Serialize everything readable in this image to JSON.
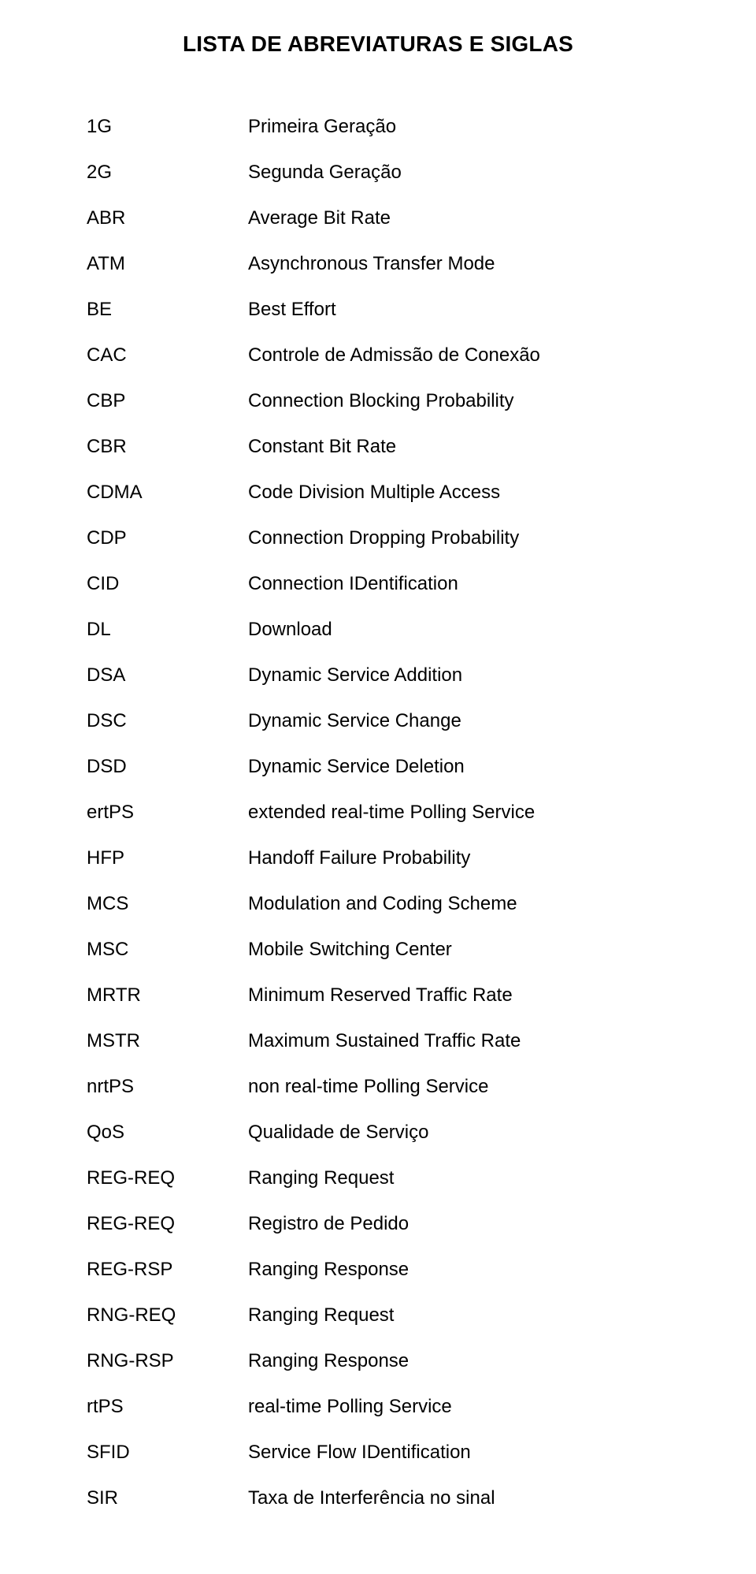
{
  "title": "LISTA DE ABREVIATURAS E SIGLAS",
  "entries": [
    {
      "abbr": "1G",
      "def": "Primeira Geração"
    },
    {
      "abbr": "2G",
      "def": "Segunda Geração"
    },
    {
      "abbr": "ABR",
      "def": "Average Bit Rate"
    },
    {
      "abbr": "ATM",
      "def": "Asynchronous Transfer Mode"
    },
    {
      "abbr": "BE",
      "def": "Best Effort"
    },
    {
      "abbr": "CAC",
      "def": "Controle de Admissão de Conexão"
    },
    {
      "abbr": "CBP",
      "def": "Connection Blocking Probability"
    },
    {
      "abbr": "CBR",
      "def": "Constant Bit Rate"
    },
    {
      "abbr": "CDMA",
      "def": "Code Division Multiple Access"
    },
    {
      "abbr": "CDP",
      "def": "Connection Dropping Probability"
    },
    {
      "abbr": "CID",
      "def": "Connection IDentification"
    },
    {
      "abbr": "DL",
      "def": "Download"
    },
    {
      "abbr": "DSA",
      "def": "Dynamic Service Addition"
    },
    {
      "abbr": "DSC",
      "def": "Dynamic Service Change"
    },
    {
      "abbr": "DSD",
      "def": "Dynamic Service Deletion"
    },
    {
      "abbr": "ertPS",
      "def": "extended real-time Polling Service"
    },
    {
      "abbr": "HFP",
      "def": "Handoff Failure Probability"
    },
    {
      "abbr": "MCS",
      "def": "Modulation and Coding Scheme"
    },
    {
      "abbr": "MSC",
      "def": "Mobile Switching Center"
    },
    {
      "abbr": "MRTR",
      "def": "Minimum Reserved Traffic Rate"
    },
    {
      "abbr": "MSTR",
      "def": "Maximum Sustained Traffic Rate"
    },
    {
      "abbr": "nrtPS",
      "def": "non real-time Polling Service"
    },
    {
      "abbr": "QoS",
      "def": "Qualidade de Serviço"
    },
    {
      "abbr": "REG-REQ",
      "def": "Ranging Request"
    },
    {
      "abbr": "REG-REQ",
      "def": "Registro de Pedido"
    },
    {
      "abbr": "REG-RSP",
      "def": "Ranging Response"
    },
    {
      "abbr": "RNG-REQ",
      "def": "Ranging Request"
    },
    {
      "abbr": "RNG-RSP",
      "def": "Ranging Response"
    },
    {
      "abbr": "rtPS",
      "def": "real-time Polling Service"
    },
    {
      "abbr": "SFID",
      "def": "Service Flow IDentification"
    },
    {
      "abbr": "SIR",
      "def": "Taxa de Interferência no sinal"
    }
  ]
}
